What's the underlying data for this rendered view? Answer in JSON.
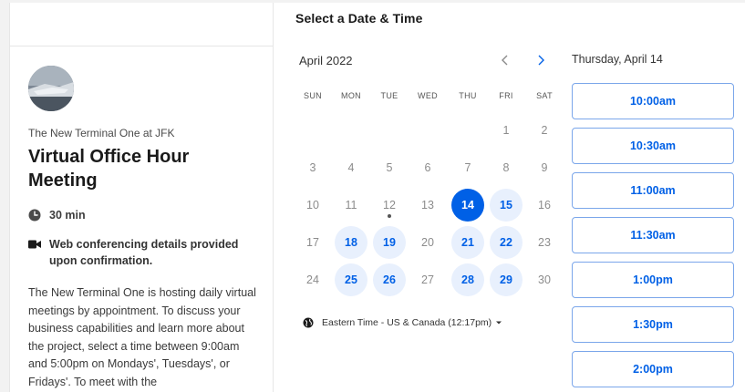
{
  "event": {
    "organization": "The New Terminal One at JFK",
    "title": "Virtual Office Hour Meeting",
    "duration": "30 min",
    "conferencing": "Web conferencing details provided upon confirmation.",
    "description": "The New Terminal One is hosting daily virtual meetings by appointment. To discuss your business capabilities and learn more about the project, select a time between 9:00am and 5:00pm on Mondays', Tuesdays', or Fridays'. To meet with the"
  },
  "scheduler": {
    "section_title": "Select a Date & Time",
    "month_label": "April 2022",
    "weekdays": [
      "SUN",
      "MON",
      "TUE",
      "WED",
      "THU",
      "FRI",
      "SAT"
    ],
    "weeks": [
      [
        null,
        null,
        null,
        null,
        null,
        {
          "d": "1",
          "s": "off"
        },
        {
          "d": "2",
          "s": "off"
        }
      ],
      [
        {
          "d": "3",
          "s": "off"
        },
        {
          "d": "4",
          "s": "off"
        },
        {
          "d": "5",
          "s": "off"
        },
        {
          "d": "6",
          "s": "off"
        },
        {
          "d": "7",
          "s": "off"
        },
        {
          "d": "8",
          "s": "off"
        },
        {
          "d": "9",
          "s": "off"
        }
      ],
      [
        {
          "d": "10",
          "s": "off"
        },
        {
          "d": "11",
          "s": "off"
        },
        {
          "d": "12",
          "s": "today"
        },
        {
          "d": "13",
          "s": "off"
        },
        {
          "d": "14",
          "s": "selected"
        },
        {
          "d": "15",
          "s": "available"
        },
        {
          "d": "16",
          "s": "off"
        }
      ],
      [
        {
          "d": "17",
          "s": "off"
        },
        {
          "d": "18",
          "s": "available"
        },
        {
          "d": "19",
          "s": "available"
        },
        {
          "d": "20",
          "s": "off"
        },
        {
          "d": "21",
          "s": "available"
        },
        {
          "d": "22",
          "s": "available"
        },
        {
          "d": "23",
          "s": "off"
        }
      ],
      [
        {
          "d": "24",
          "s": "off"
        },
        {
          "d": "25",
          "s": "available"
        },
        {
          "d": "26",
          "s": "available"
        },
        {
          "d": "27",
          "s": "off"
        },
        {
          "d": "28",
          "s": "available"
        },
        {
          "d": "29",
          "s": "available"
        },
        {
          "d": "30",
          "s": "off"
        }
      ]
    ],
    "timezone_label": "Eastern Time - US & Canada (12:17pm)",
    "selected_date_label": "Thursday, April 14",
    "time_slots": [
      "10:00am",
      "10:30am",
      "11:00am",
      "11:30am",
      "1:00pm",
      "1:30pm",
      "2:00pm"
    ]
  },
  "icons": {
    "prev": "chevron-left-icon",
    "next": "chevron-right-icon",
    "duration": "clock-icon",
    "conferencing": "video-camera-icon",
    "timezone": "globe-icon",
    "dropdown": "caret-down-icon"
  },
  "colors": {
    "accent": "#0060e6",
    "available_bg": "#e8f0fd",
    "slot_border": "#7aa6ea"
  }
}
